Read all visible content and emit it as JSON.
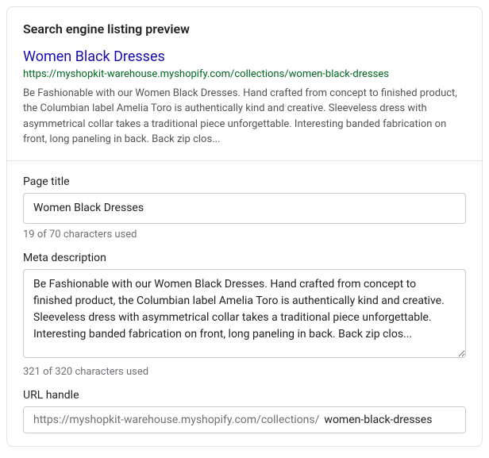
{
  "header": {
    "title": "Search engine listing preview"
  },
  "preview": {
    "title": "Women Black Dresses",
    "url": "https://myshopkit-warehouse.myshopify.com/collections/women-black-dresses",
    "description": "Be Fashionable with our Women Black Dresses. Hand crafted from concept to finished product, the Columbian label Amelia Toro is authentically kind and creative. Sleeveless dress with asymmetrical collar takes a traditional piece unforgettable. Interesting banded fabrication on front, long paneling in back. Back zip clos..."
  },
  "fields": {
    "pageTitle": {
      "label": "Page title",
      "value": "Women Black Dresses",
      "helper": "19 of 70 characters used"
    },
    "metaDescription": {
      "label": "Meta description",
      "value": "Be Fashionable with our Women Black Dresses. Hand crafted from concept to finished product, the Columbian label Amelia Toro is authentically kind and creative. Sleeveless dress with asymmetrical collar takes a traditional piece unforgettable. Interesting banded fabrication on front, long paneling in back. Back zip clos...",
      "helper": "321 of 320 characters used"
    },
    "urlHandle": {
      "label": "URL handle",
      "prefix": "https://myshopkit-warehouse.myshopify.com/collections/",
      "value": "women-black-dresses"
    }
  }
}
